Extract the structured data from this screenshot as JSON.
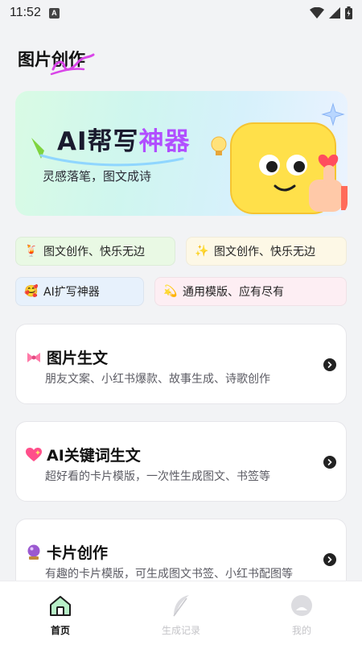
{
  "status_bar": {
    "time": "11:52"
  },
  "header": {
    "title": "图片创作"
  },
  "banner": {
    "title_main": "AI帮写",
    "title_highlight": "神器",
    "subtitle": "灵感落笔，图文成诗"
  },
  "tags": [
    {
      "label": "图文创作、快乐无边",
      "icon": "cocktail-icon"
    },
    {
      "label": "图文创作、快乐无边",
      "icon": "sparkles-icon"
    },
    {
      "label": "AI扩写神器",
      "icon": "smiling-hearts-icon"
    },
    {
      "label": "通用模版、应有尽有",
      "icon": "dizzy-star-icon"
    }
  ],
  "cards": [
    {
      "title": "图片生文",
      "desc": "朋友文案、小红书爆款、故事生成、诗歌创作",
      "icon": "ribbon-icon"
    },
    {
      "title": "AI关键词生文",
      "desc": "超好看的卡片模版，一次性生成图文、书签等",
      "icon": "sparkling-heart-icon"
    },
    {
      "title": "卡片创作",
      "desc": "有趣的卡片模版，可生成图文书签、小红书配图等",
      "icon": "crystal-ball-icon"
    }
  ],
  "bottom_nav": [
    {
      "label": "首页",
      "icon": "home-icon",
      "active": true
    },
    {
      "label": "生成记录",
      "icon": "feather-icon",
      "active": false
    },
    {
      "label": "我的",
      "icon": "profile-icon",
      "active": false
    }
  ]
}
